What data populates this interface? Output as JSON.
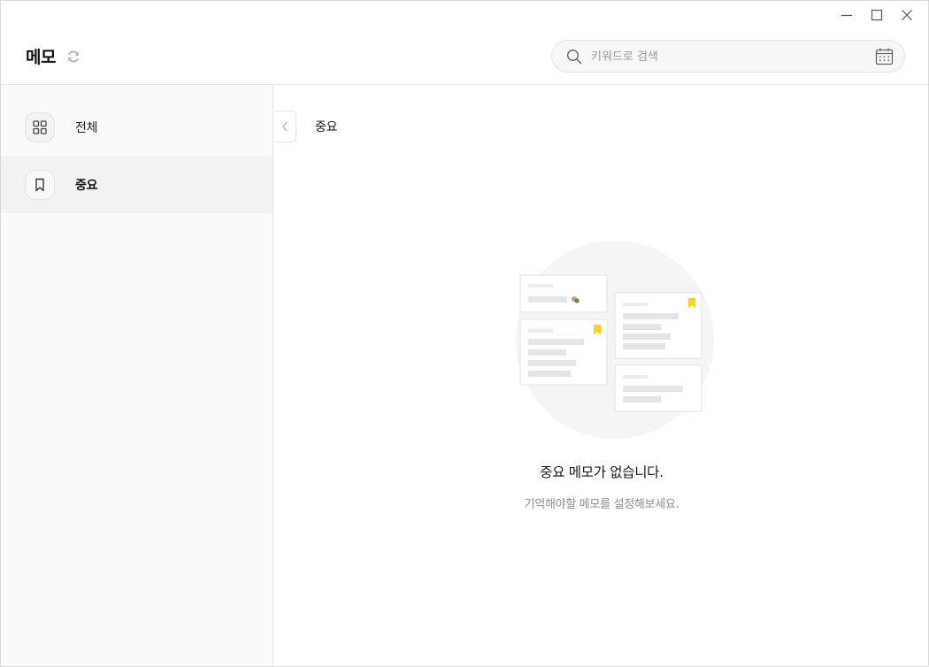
{
  "app": {
    "title": "메모"
  },
  "window_controls": {
    "minimize": "minimize-icon",
    "maximize": "maximize-icon",
    "close": "close-icon"
  },
  "search": {
    "placeholder": "키워드로 검색",
    "value": ""
  },
  "sidebar": {
    "items": [
      {
        "label": "전체",
        "icon": "grid-icon",
        "active": false
      },
      {
        "label": "중요",
        "icon": "bookmark-icon",
        "active": true
      }
    ]
  },
  "main": {
    "title": "중요",
    "empty_title": "중요 메모가 없습니다.",
    "empty_subtitle": "기억해야할 메모를 설정해보세요."
  },
  "colors": {
    "accent_bookmark": "#ffd400",
    "text_primary": "#1a1a1a",
    "text_secondary": "#8c8c8c",
    "sidebar_bg": "#fafafa",
    "active_item_bg": "#f2f2f2"
  }
}
